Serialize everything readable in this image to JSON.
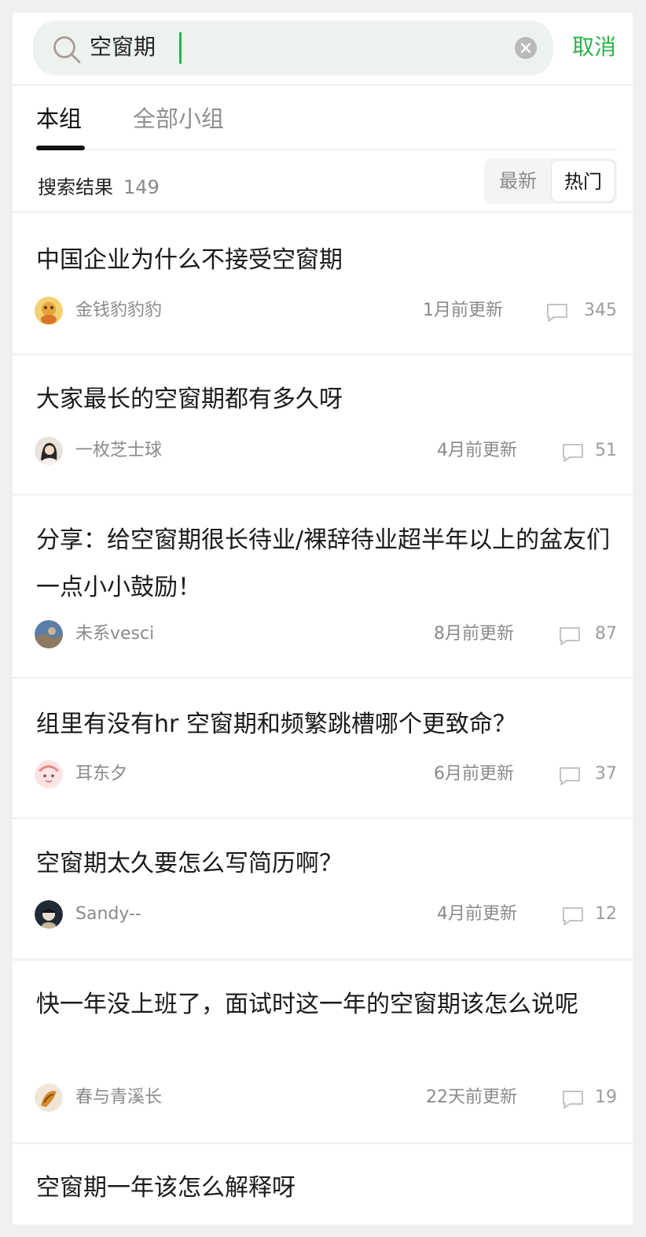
{
  "search": {
    "query": "空窗期",
    "cancel_label": "取消"
  },
  "tabs": [
    {
      "label": "本组",
      "active": true
    },
    {
      "label": "全部小组",
      "active": false
    }
  ],
  "results": {
    "label": "搜索结果",
    "count": "149"
  },
  "sort": {
    "options": [
      "最新",
      "热门"
    ],
    "selected": "热门"
  },
  "colors": {
    "accent": "#2bb24c"
  },
  "posts": [
    {
      "title": "中国企业为什么不接受空窗期",
      "author": "金钱豹豹豹",
      "updated": "1月前更新",
      "comments": "345",
      "avatar_icon": "cartoon-avatar"
    },
    {
      "title": "大家最长的空窗期都有多久呀",
      "author": "一枚芝士球",
      "updated": "4月前更新",
      "comments": "51",
      "avatar_icon": "portrait-avatar"
    },
    {
      "title": "分享：给空窗期很长待业/裸辞待业超半年以上的盆友们一点小小鼓励！",
      "author": "未系vesci",
      "updated": "8月前更新",
      "comments": "87",
      "avatar_icon": "landscape-avatar"
    },
    {
      "title": "组里有没有hr 空窗期和频繁跳槽哪个更致命？",
      "author": "耳东夕",
      "updated": "6月前更新",
      "comments": "37",
      "avatar_icon": "pink-cartoon-avatar"
    },
    {
      "title": "空窗期太久要怎么写简历啊？",
      "author": "Sandy--",
      "updated": "4月前更新",
      "comments": "12",
      "avatar_icon": "dark-portrait-avatar"
    },
    {
      "title": "快一年没上班了，面试时这一年的空窗期该怎么说呢",
      "author": "春与青溪长",
      "updated": "22天前更新",
      "comments": "19",
      "avatar_icon": "orange-avatar"
    },
    {
      "title": "空窗期一年该怎么解释呀"
    }
  ]
}
